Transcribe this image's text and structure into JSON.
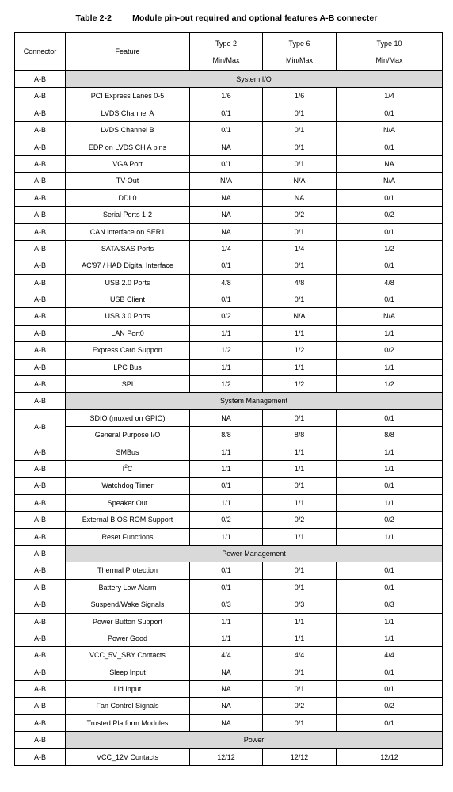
{
  "caption": {
    "number": "Table 2-2",
    "text": "Module pin-out required and optional features A-B connecter"
  },
  "colors": {
    "section_band": "#d9d9d9",
    "border": "#000000",
    "text": "#000000",
    "page_background": "#ffffff"
  },
  "table": {
    "headers": {
      "connector": "Connector",
      "feature": "Feature",
      "type2_line1": "Type 2",
      "type2_line2": "Min/Max",
      "type6_line1": "Type 6",
      "type6_line2": "Min/Max",
      "type10_line1": "Type 10",
      "type10_line2": "Min/Max"
    },
    "connector_value": "A-B",
    "sections": [
      {
        "title": "System I/O",
        "rows": [
          {
            "connector": "A-B",
            "feature": "PCI Express Lanes 0-5",
            "type2": "1/6",
            "type6": "1/6",
            "type10": "1/4"
          },
          {
            "connector": "A-B",
            "feature": "LVDS Channel A",
            "type2": "0/1",
            "type6": "0/1",
            "type10": "0/1"
          },
          {
            "connector": "A-B",
            "feature": "LVDS Channel B",
            "type2": "0/1",
            "type6": "0/1",
            "type10": "N/A"
          },
          {
            "connector": "A-B",
            "feature": "EDP on LVDS CH A pins",
            "type2": "NA",
            "type6": "0/1",
            "type10": "0/1"
          },
          {
            "connector": "A-B",
            "feature": "VGA Port",
            "type2": "0/1",
            "type6": "0/1",
            "type10": "NA"
          },
          {
            "connector": "A-B",
            "feature": "TV-Out",
            "type2": "N/A",
            "type6": "N/A",
            "type10": "N/A"
          },
          {
            "connector": "A-B",
            "feature": "DDI 0",
            "type2": "NA",
            "type6": "NA",
            "type10": "0/1"
          },
          {
            "connector": "A-B",
            "feature": "Serial Ports 1-2",
            "type2": "NA",
            "type6": "0/2",
            "type10": "0/2"
          },
          {
            "connector": "A-B",
            "feature": "CAN interface on SER1",
            "type2": "NA",
            "type6": "0/1",
            "type10": "0/1"
          },
          {
            "connector": "A-B",
            "feature": "SATA/SAS Ports",
            "type2": "1/4",
            "type6": "1/4",
            "type10": "1/2"
          },
          {
            "connector": "A-B",
            "feature": "AC'97 / HAD Digital Interface",
            "type2": "0/1",
            "type6": "0/1",
            "type10": "0/1"
          },
          {
            "connector": "A-B",
            "feature": "USB 2.0 Ports",
            "type2": "4/8",
            "type6": "4/8",
            "type10": "4/8"
          },
          {
            "connector": "A-B",
            "feature": "USB Client",
            "type2": "0/1",
            "type6": "0/1",
            "type10": "0/1"
          },
          {
            "connector": "A-B",
            "feature": "USB 3.0 Ports",
            "type2": "0/2",
            "type6": "N/A",
            "type10": "N/A"
          },
          {
            "connector": "A-B",
            "feature": "LAN Port0",
            "type2": "1/1",
            "type6": "1/1",
            "type10": "1/1"
          },
          {
            "connector": "A-B",
            "feature": "Express Card Support",
            "type2": "1/2",
            "type6": "1/2",
            "type10": "0/2"
          },
          {
            "connector": "A-B",
            "feature": "LPC Bus",
            "type2": "1/1",
            "type6": "1/1",
            "type10": "1/1"
          },
          {
            "connector": "A-B",
            "feature": "SPI",
            "type2": "1/2",
            "type6": "1/2",
            "type10": "1/2"
          }
        ]
      },
      {
        "title": "System Management",
        "rows": [
          {
            "connector": "A-B",
            "connector_rowspan": 2,
            "feature": "SDIO (muxed on GPIO)",
            "type2": "NA",
            "type6": "0/1",
            "type10": "0/1"
          },
          {
            "connector": "",
            "connector_hidden": true,
            "feature": "General Purpose I/O",
            "type2": "8/8",
            "type6": "8/8",
            "type10": "8/8"
          },
          {
            "connector": "A-B",
            "feature": "SMBus",
            "type2": "1/1",
            "type6": "1/1",
            "type10": "1/1"
          },
          {
            "connector": "A-B",
            "feature": "I2C",
            "feature_html": "I<sup>2</sup>C",
            "type2": "1/1",
            "type6": "1/1",
            "type10": "1/1"
          },
          {
            "connector": "A-B",
            "feature": "Watchdog Timer",
            "type2": "0/1",
            "type6": "0/1",
            "type10": "0/1"
          },
          {
            "connector": "A-B",
            "feature": "Speaker Out",
            "type2": "1/1",
            "type6": "1/1",
            "type10": "1/1"
          },
          {
            "connector": "A-B",
            "feature": "External BIOS ROM Support",
            "type2": "0/2",
            "type6": "0/2",
            "type10": "0/2"
          },
          {
            "connector": "A-B",
            "feature": "Reset Functions",
            "type2": "1/1",
            "type6": "1/1",
            "type10": "1/1"
          }
        ]
      },
      {
        "title": "Power Management",
        "rows": [
          {
            "connector": "A-B",
            "feature": "Thermal Protection",
            "type2": "0/1",
            "type6": "0/1",
            "type10": "0/1"
          },
          {
            "connector": "A-B",
            "feature": "Battery Low Alarm",
            "type2": "0/1",
            "type6": "0/1",
            "type10": "0/1"
          },
          {
            "connector": "A-B",
            "feature": "Suspend/Wake Signals",
            "type2": "0/3",
            "type6": "0/3",
            "type10": "0/3"
          },
          {
            "connector": "A-B",
            "feature": "Power Button Support",
            "type2": "1/1",
            "type6": "1/1",
            "type10": "1/1"
          },
          {
            "connector": "A-B",
            "feature": "Power Good",
            "type2": "1/1",
            "type6": "1/1",
            "type10": "1/1"
          },
          {
            "connector": "A-B",
            "feature": "VCC_5V_SBY Contacts",
            "type2": "4/4",
            "type6": "4/4",
            "type10": "4/4"
          },
          {
            "connector": "A-B",
            "feature": "Sleep Input",
            "type2": "NA",
            "type6": "0/1",
            "type10": "0/1"
          },
          {
            "connector": "A-B",
            "feature": "Lid Input",
            "type2": "NA",
            "type6": "0/1",
            "type10": "0/1"
          },
          {
            "connector": "A-B",
            "feature": "Fan Control Signals",
            "type2": "NA",
            "type6": "0/2",
            "type10": "0/2"
          },
          {
            "connector": "A-B",
            "feature": "Trusted Platform Modules",
            "type2": "NA",
            "type6": "0/1",
            "type10": "0/1"
          }
        ]
      },
      {
        "title": "Power",
        "rows": [
          {
            "connector": "A-B",
            "feature": "VCC_12V Contacts",
            "type2": "12/12",
            "type6": "12/12",
            "type10": "12/12"
          }
        ]
      }
    ]
  }
}
